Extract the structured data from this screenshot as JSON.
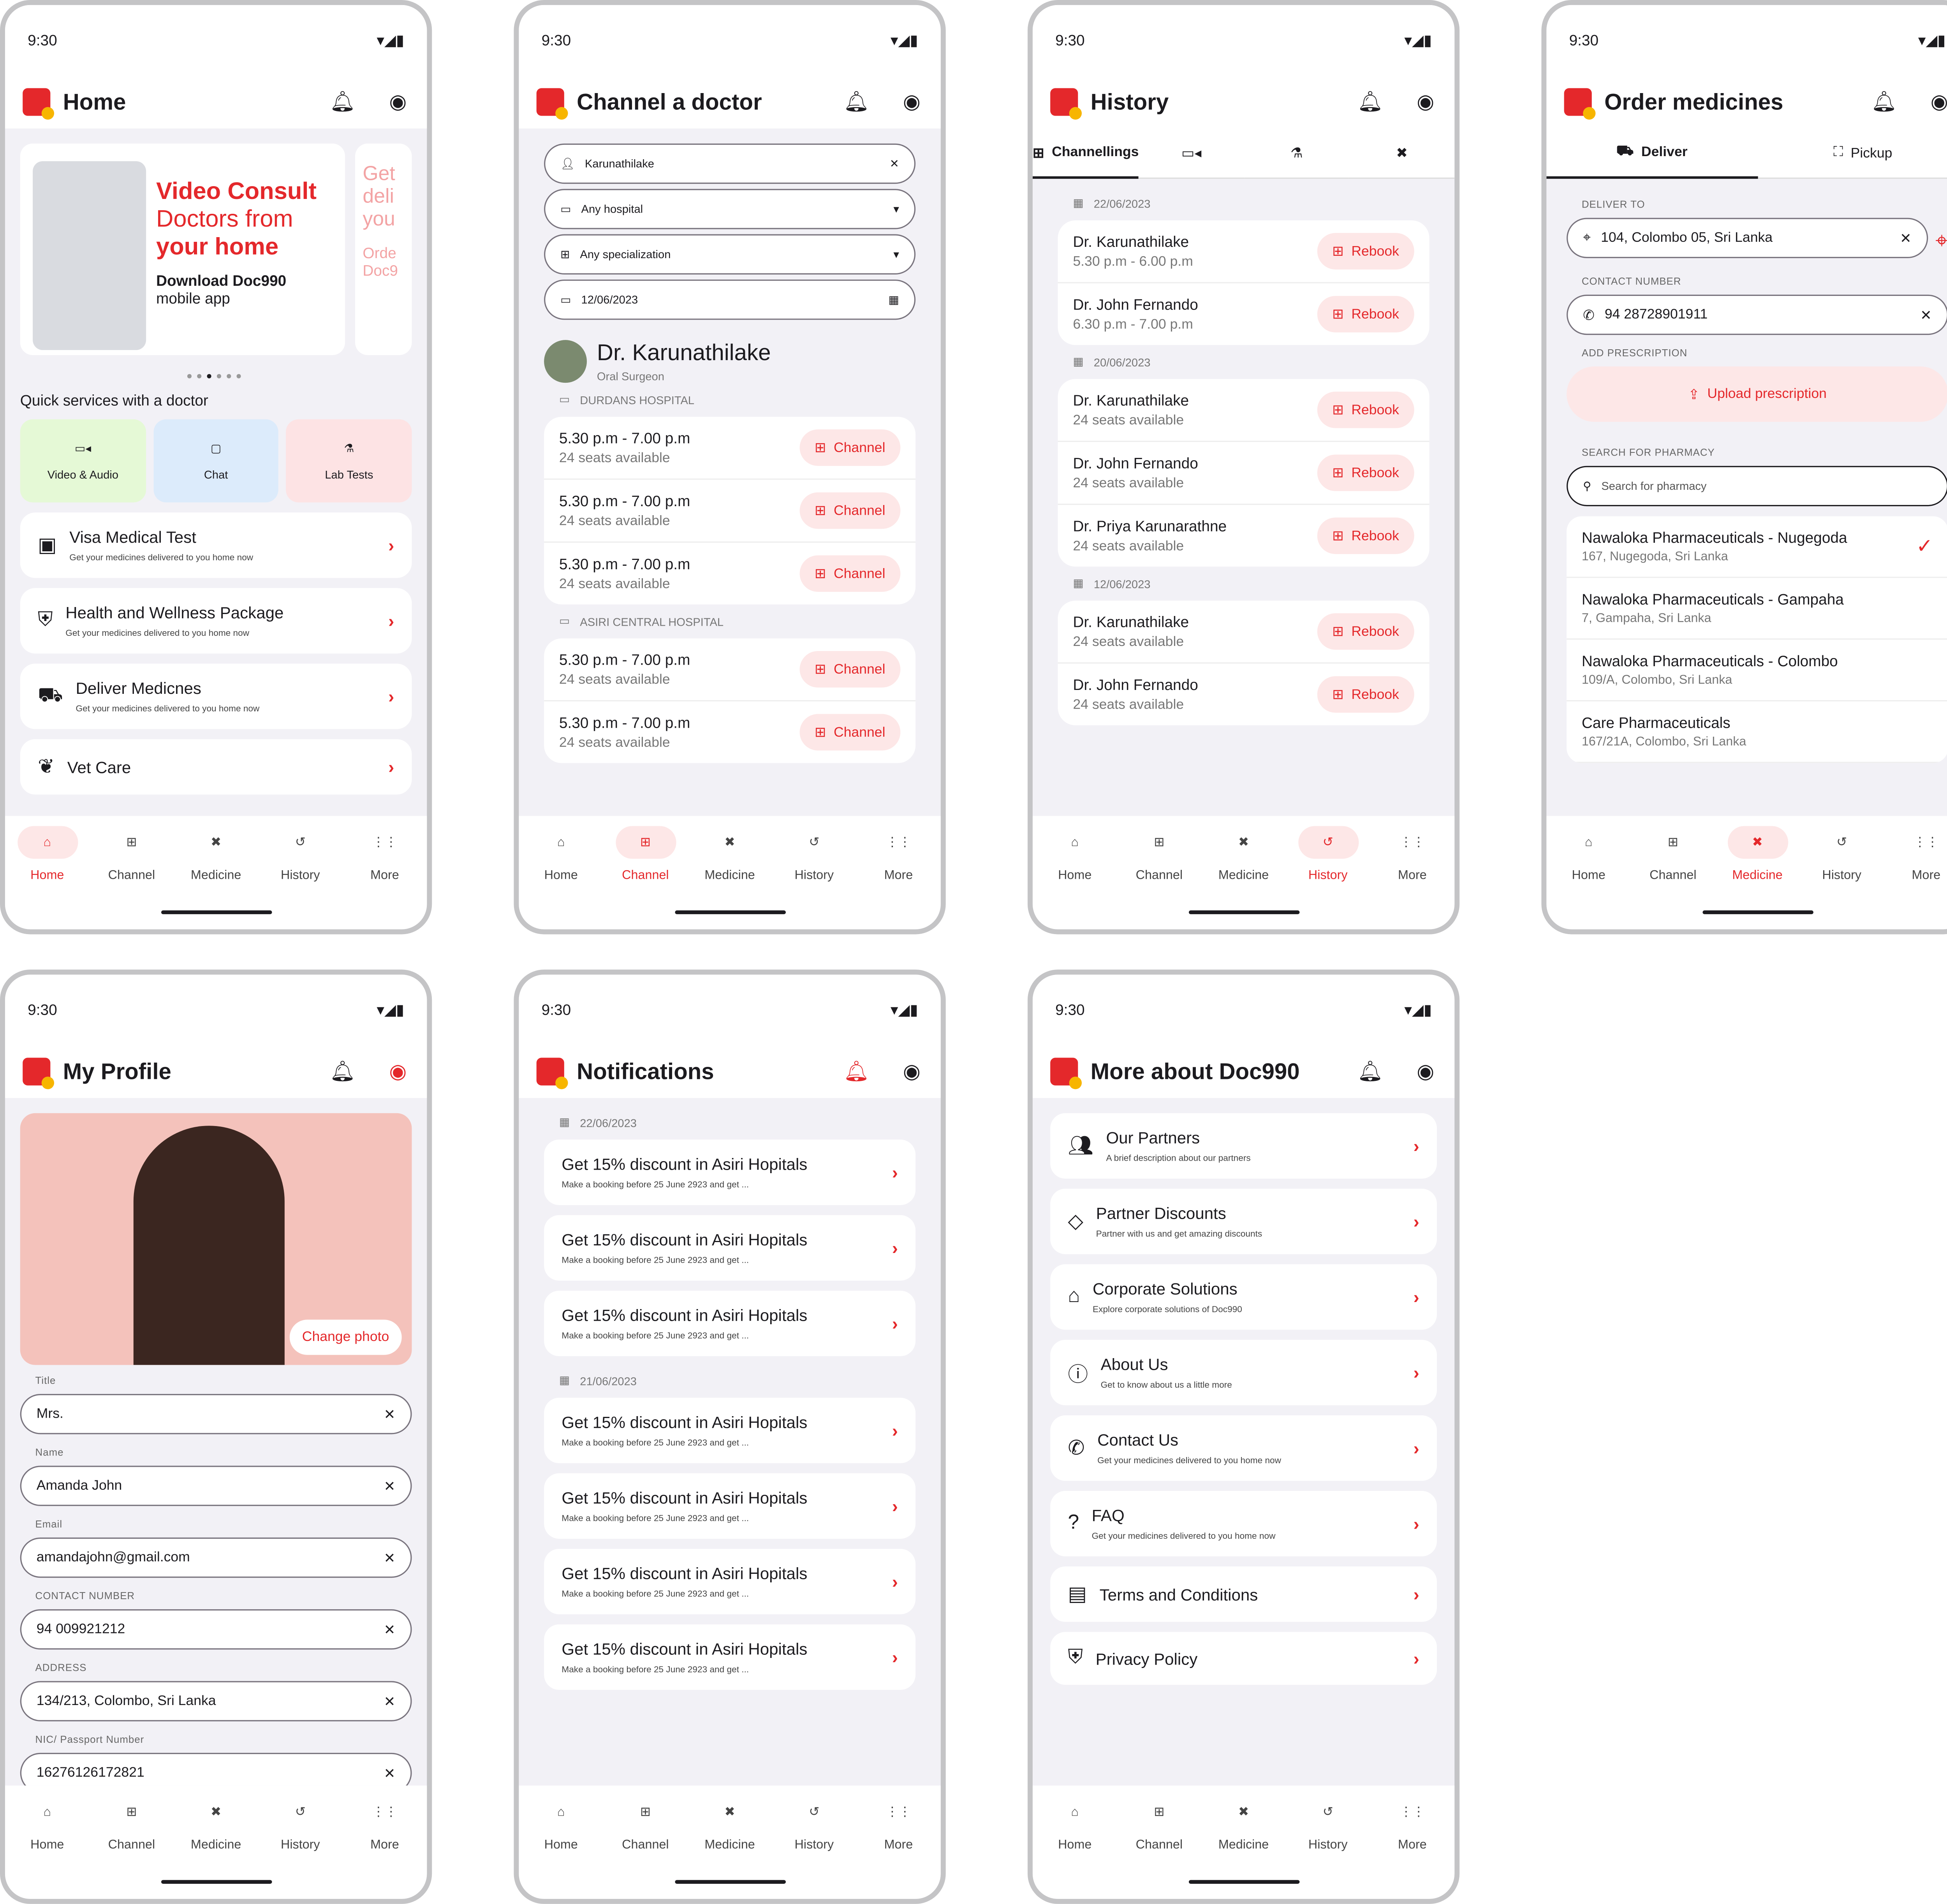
{
  "status_time": "9:30",
  "nav": [
    "Home",
    "Channel",
    "Medicine",
    "History",
    "More"
  ],
  "home": {
    "title": "Home",
    "banner": {
      "line1": "Video Consult",
      "line2": "Doctors from",
      "line3": "your home",
      "cta": "Download Doc990",
      "sub": "mobile app",
      "peek1": "Get",
      "peek2": "deli",
      "peek3": "you",
      "peek4": "Orde",
      "peek5": "Doc9"
    },
    "quick_title": "Quick services with a doctor",
    "quick": [
      "Video & Audio",
      "Chat",
      "Lab Tests"
    ],
    "cards": [
      {
        "title": "Visa Medical Test",
        "sub": "Get your medicines delivered to you home now"
      },
      {
        "title": "Health and Wellness Package",
        "sub": "Get your medicines delivered to you home now"
      },
      {
        "title": "Deliver Medicnes",
        "sub": "Get your medicines delivered to you home now"
      },
      {
        "title": "Vet Care",
        "sub": ""
      }
    ]
  },
  "channel": {
    "title": "Channel a doctor",
    "doctor_input": "Karunathilake",
    "hospital": "Any hospital",
    "specialization": "Any specialization",
    "date": "12/06/2023",
    "doctor_name": "Dr. Karunathilake",
    "doctor_spec": "Oral Surgeon",
    "hospital1": "DURDANS HOSPITAL",
    "hospital2": "ASIRI CENTRAL HOSPITAL",
    "slot_time": "5.30 p.m - 7.00 p.m",
    "seats": "24 seats available",
    "btn": "Channel"
  },
  "history": {
    "title": "History",
    "tab1": "Channellings",
    "rebook": "Rebook",
    "groups": [
      {
        "date": "22/06/2023",
        "items": [
          {
            "n": "Dr. Karunathilake",
            "s": "5.30 p.m - 6.00 p.m"
          },
          {
            "n": "Dr. John Fernando",
            "s": "6.30 p.m - 7.00 p.m"
          }
        ]
      },
      {
        "date": "20/06/2023",
        "items": [
          {
            "n": "Dr. Karunathilake",
            "s": "24 seats available"
          },
          {
            "n": "Dr. John Fernando",
            "s": "24 seats available"
          },
          {
            "n": "Dr. Priya Karunarathne",
            "s": "24 seats available"
          }
        ]
      },
      {
        "date": "12/06/2023",
        "items": [
          {
            "n": "Dr. Karunathilake",
            "s": "24 seats available"
          },
          {
            "n": "Dr. John Fernando",
            "s": "24 seats available"
          }
        ]
      }
    ]
  },
  "order": {
    "title": "Order medicines",
    "tab1": "Deliver",
    "tab2": "Pickup",
    "deliver_label": "DELIVER TO",
    "address": "104, Colombo 05, Sri Lanka",
    "contact_label": "CONTACT NUMBER",
    "contact": "94 28728901911",
    "presc_label": "ADD PRESCRIPTION",
    "upload": "Upload prescription",
    "search_label": "SEARCH FOR PHARMACY",
    "search_ph": "Search for pharmacy",
    "pharmacies": [
      {
        "n": "Nawaloka Pharmaceuticals - Nugegoda",
        "a": "167, Nugegoda, Sri Lanka"
      },
      {
        "n": "Nawaloka Pharmaceuticals - Gampaha",
        "a": "7, Gampaha, Sri Lanka"
      },
      {
        "n": "Nawaloka Pharmaceuticals - Colombo",
        "a": "109/A, Colombo, Sri Lanka"
      },
      {
        "n": "Care Pharmaceuticals",
        "a": "167/21A, Colombo, Sri Lanka"
      }
    ]
  },
  "profile": {
    "title": "My Profile",
    "change_photo": "Change photo",
    "fields": [
      {
        "label": "Title",
        "value": "Mrs."
      },
      {
        "label": "Name",
        "value": "Amanda John"
      },
      {
        "label": "Email",
        "value": "amandajohn@gmail.com"
      },
      {
        "label": "CONTACT NUMBER",
        "value": "94 009921212"
      },
      {
        "label": "ADDRESS",
        "value": "134/213, Colombo, Sri Lanka"
      },
      {
        "label": "NIC/ Passport Number",
        "value": "16276126172821"
      }
    ]
  },
  "notifications": {
    "title": "Notifications",
    "date1": "22/06/2023",
    "date2": "21/06/2023",
    "item_title": "Get 15% discount in Asiri Hopitals",
    "item_sub": "Make a booking before 25 June 2923 and get ..."
  },
  "more": {
    "title": "More about Doc990",
    "items": [
      {
        "t": "Our Partners",
        "s": "A brief description about our partners"
      },
      {
        "t": "Partner Discounts",
        "s": "Partner with us and get amazing discounts"
      },
      {
        "t": "Corporate Solutions",
        "s": "Explore corporate solutions of Doc990"
      },
      {
        "t": "About Us",
        "s": "Get to know about us a little more"
      },
      {
        "t": "Contact Us",
        "s": "Get your medicines delivered to you home now"
      },
      {
        "t": "FAQ",
        "s": "Get your medicines delivered to you home now"
      },
      {
        "t": "Terms and Conditions",
        "s": ""
      },
      {
        "t": "Privacy Policy",
        "s": ""
      }
    ]
  },
  "colors": {
    "accent": "#e4282b",
    "background": "#f2f1f6"
  }
}
